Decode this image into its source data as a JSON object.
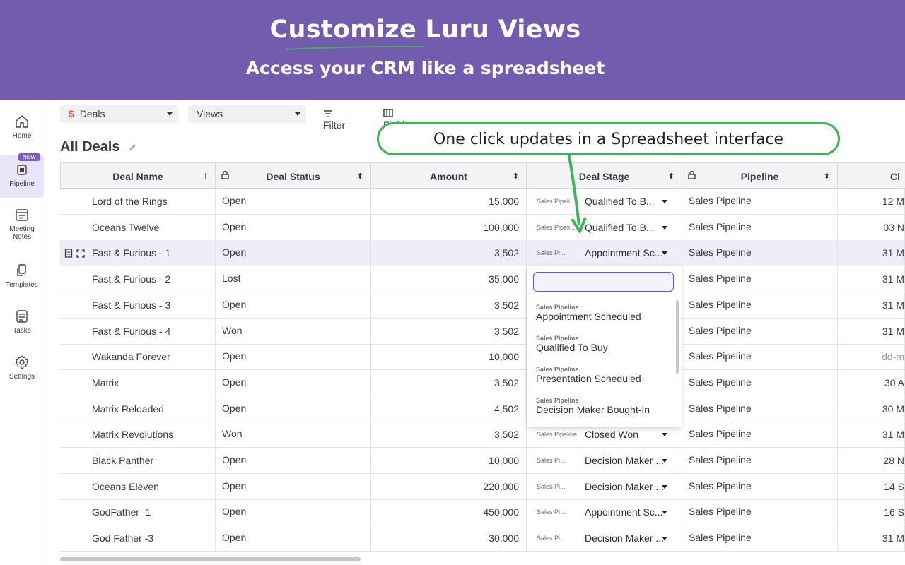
{
  "banner": {
    "title": "Customize Luru Views",
    "subtitle": "Access your CRM like a spreadsheet"
  },
  "callout": {
    "text": "One click updates in a Spreadsheet interface"
  },
  "sidebar": {
    "items": [
      {
        "label": "Home",
        "icon": "home-icon"
      },
      {
        "label": "Pipeline",
        "icon": "pipeline-icon",
        "badge": "NEW",
        "active": true
      },
      {
        "label": "Meeting Notes",
        "icon": "calendar-icon"
      },
      {
        "label": "Templates",
        "icon": "copy-icon"
      },
      {
        "label": "Tasks",
        "icon": "tasks-icon"
      },
      {
        "label": "Settings",
        "icon": "gear-icon"
      }
    ]
  },
  "toolbar": {
    "object_select": "Deals",
    "views_select": "Views",
    "filter_label": "Filter",
    "fields_label": "Fields"
  },
  "page": {
    "title": "All Deals"
  },
  "table": {
    "columns": [
      "Deal Name",
      "Deal Status",
      "Amount",
      "Deal Stage",
      "Pipeline",
      "Cl"
    ],
    "rows": [
      {
        "name": "Lord of the Rings",
        "status": "Open",
        "amount": "15,000",
        "stage_pipeline": "Sales Pipeli...",
        "stage": "Qualified To B...",
        "pipeline": "Sales Pipeline",
        "close": "12 M"
      },
      {
        "name": "Oceans Twelve",
        "status": "Open",
        "amount": "100,000",
        "stage_pipeline": "Sales Pipeli...",
        "stage": "Qualified To B...",
        "pipeline": "Sales Pipeline",
        "close": "03 N"
      },
      {
        "name": "Fast & Furious - 1",
        "status": "Open",
        "amount": "3,502",
        "stage_pipeline": "Sales Pi...",
        "stage": "Appointment Sc...",
        "pipeline": "Sales Pipeline",
        "close": "31 M"
      },
      {
        "name": "Fast & Furious - 2",
        "status": "Lost",
        "amount": "35,000",
        "stage_pipeline": "",
        "stage": "",
        "pipeline": "Sales Pipeline",
        "close": "31 M"
      },
      {
        "name": "Fast & Furious - 3",
        "status": "Open",
        "amount": "3,502",
        "stage_pipeline": "",
        "stage": "",
        "pipeline": "Sales Pipeline",
        "close": "31 M"
      },
      {
        "name": "Fast & Furious - 4",
        "status": "Won",
        "amount": "3,502",
        "stage_pipeline": "",
        "stage": "",
        "pipeline": "Sales Pipeline",
        "close": "31 M"
      },
      {
        "name": "Wakanda Forever",
        "status": "Open",
        "amount": "10,000",
        "stage_pipeline": "",
        "stage": "",
        "pipeline": "Sales Pipeline",
        "close": "dd-m"
      },
      {
        "name": "Matrix",
        "status": "Open",
        "amount": "3,502",
        "stage_pipeline": "",
        "stage": "",
        "pipeline": "Sales Pipeline",
        "close": "30 A"
      },
      {
        "name": "Matrix Reloaded",
        "status": "Open",
        "amount": "4,502",
        "stage_pipeline": "",
        "stage": "",
        "pipeline": "Sales Pipeline",
        "close": "30 M"
      },
      {
        "name": "Matrix Revolutions",
        "status": "Won",
        "amount": "3,502",
        "stage_pipeline": "Sales Pipeline",
        "stage": "Closed Won",
        "pipeline": "Sales Pipeline",
        "close": "31 M"
      },
      {
        "name": "Black Panther",
        "status": "Open",
        "amount": "10,000",
        "stage_pipeline": "Sales Pi...",
        "stage": "Decision Maker ...",
        "pipeline": "Sales Pipeline",
        "close": "28 N"
      },
      {
        "name": "Oceans Eleven",
        "status": "Open",
        "amount": "220,000",
        "stage_pipeline": "Sales Pi...",
        "stage": "Decision Maker ...",
        "pipeline": "Sales Pipeline",
        "close": "14 S"
      },
      {
        "name": "GodFather -1",
        "status": "Open",
        "amount": "450,000",
        "stage_pipeline": "Sales Pi...",
        "stage": "Appointment Sc...",
        "pipeline": "Sales Pipeline",
        "close": "16 S"
      },
      {
        "name": "God Father -3",
        "status": "Open",
        "amount": "30,000",
        "stage_pipeline": "Sales Pi...",
        "stage": "Decision Maker ...",
        "pipeline": "Sales Pipeline",
        "close": "31 M"
      }
    ]
  },
  "dropdown": {
    "search_value": "",
    "options": [
      {
        "pipeline": "Sales Pipeline",
        "stage": "Appointment Scheduled"
      },
      {
        "pipeline": "Sales Pipeline",
        "stage": "Qualified To Buy"
      },
      {
        "pipeline": "Sales Pipeline",
        "stage": "Presentation Scheduled"
      },
      {
        "pipeline": "Sales Pipeline",
        "stage": "Decision Maker Bought-In"
      }
    ]
  },
  "colors": {
    "banner": "#735cad",
    "accent": "#7b5fc7",
    "callout_border": "#3cb55a",
    "row_highlight": "#eeeef8"
  }
}
